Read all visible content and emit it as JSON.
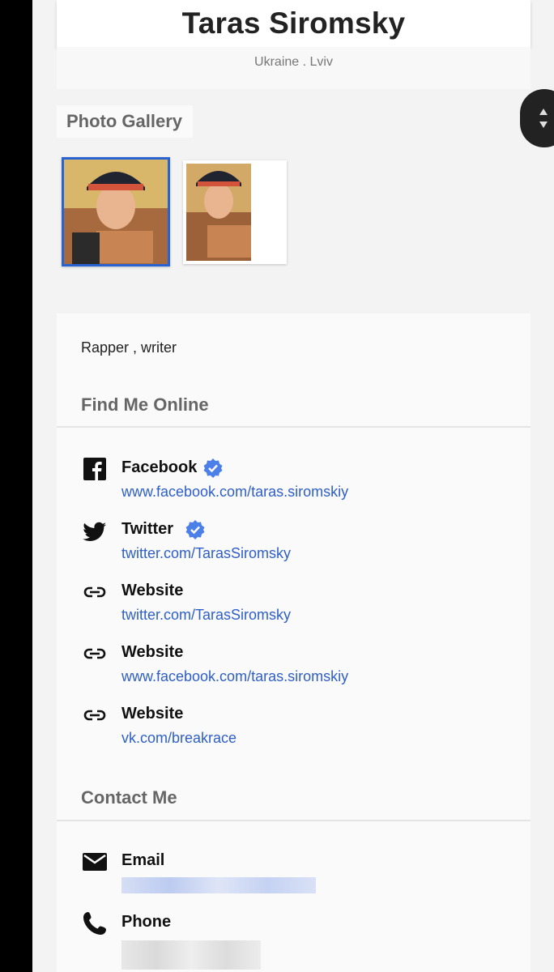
{
  "profile": {
    "name": "Taras Siromsky",
    "location": "Ukraine . Lviv",
    "bio": "Rapper , writer"
  },
  "gallery": {
    "title": "Photo Gallery",
    "photos": [
      "profile-photo-1",
      "profile-photo-2"
    ]
  },
  "online": {
    "title": "Find Me Online",
    "items": [
      {
        "label": "Facebook",
        "link": "www.facebook.com/taras.siromskiy",
        "icon": "facebook-icon",
        "verified": true
      },
      {
        "label": "Twitter",
        "link": "twitter.com/TarasSiromsky",
        "icon": "twitter-icon",
        "verified": true
      },
      {
        "label": "Website",
        "link": "twitter.com/TarasSiromsky",
        "icon": "link-icon",
        "verified": false
      },
      {
        "label": "Website",
        "link": "www.facebook.com/taras.siromskiy",
        "icon": "link-icon",
        "verified": false
      },
      {
        "label": "Website",
        "link": "vk.com/breakrace",
        "icon": "link-icon",
        "verified": false
      }
    ]
  },
  "contact": {
    "title": "Contact Me",
    "items": [
      {
        "label": "Email",
        "icon": "mail-icon"
      },
      {
        "label": "Phone",
        "icon": "phone-icon"
      }
    ]
  },
  "colors": {
    "link": "#2e5fc8",
    "verified": "#4a80e8",
    "selected_border": "#2962d1"
  }
}
